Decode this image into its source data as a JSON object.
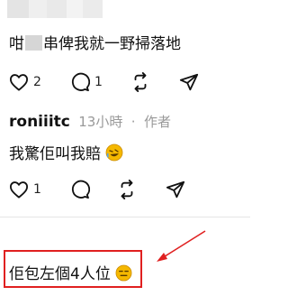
{
  "post": {
    "text_before": "咁",
    "text_after": "串俾我就一野掃落地",
    "likes": "2",
    "replies": "1"
  },
  "reply": {
    "username": "roniiitc",
    "time": "13小時",
    "separator": "·",
    "role": "作者",
    "text": "我驚佢叫我賠",
    "emoji": "rolling-laughing-emoji",
    "likes": "1"
  },
  "comment": {
    "text": "佢包左個4人位",
    "emoji": "expressionless-emoji"
  },
  "colors": {
    "highlight": "#e02020",
    "muted": "#999999",
    "emoji": "#f5b800"
  }
}
